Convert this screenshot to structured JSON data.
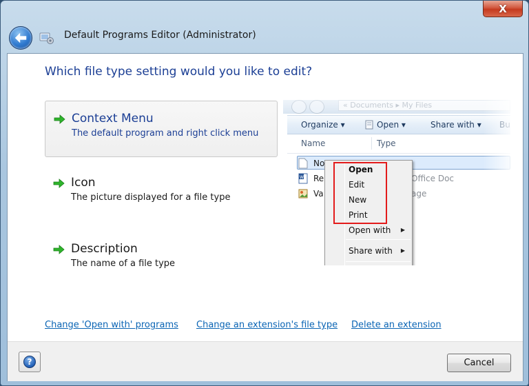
{
  "window": {
    "title": "Default Programs Editor (Administrator)",
    "close_label": "X"
  },
  "main": {
    "question": "Which file type setting would you like to edit?",
    "options": [
      {
        "title": "Context Menu",
        "description": "The default program and right click menu",
        "selected": true
      },
      {
        "title": "Icon",
        "description": "The picture displayed for a file type",
        "selected": false
      },
      {
        "title": "Description",
        "description": "The name of a file type",
        "selected": false
      }
    ]
  },
  "preview": {
    "address": "« Documents ▸ My Files",
    "toolbar": [
      "Organize ▾",
      "Open ▾",
      "Share with ▾",
      "Bur"
    ],
    "columns": [
      "Name",
      "Type"
    ],
    "files": [
      {
        "name": "No",
        "icon": "text-file-icon"
      },
      {
        "name": "Re",
        "icon": "word-document-icon"
      },
      {
        "name": "Va",
        "icon": "image-file-icon"
      }
    ],
    "types": [
      "Office Doc",
      "age"
    ],
    "context_menu": {
      "items": [
        "Open",
        "Edit",
        "New",
        "Print"
      ],
      "submenus": [
        "Open with",
        "Share with"
      ]
    }
  },
  "links": {
    "open_with": "Change 'Open with' programs",
    "extension_type": "Change an extension's file type",
    "delete_extension": "Delete an extension"
  },
  "footer": {
    "help_label": "?",
    "cancel_label": "Cancel"
  },
  "colors": {
    "accent_blue": "#1c3f95",
    "link_blue": "#0a64b4",
    "highlight_red": "#e31a1a"
  }
}
